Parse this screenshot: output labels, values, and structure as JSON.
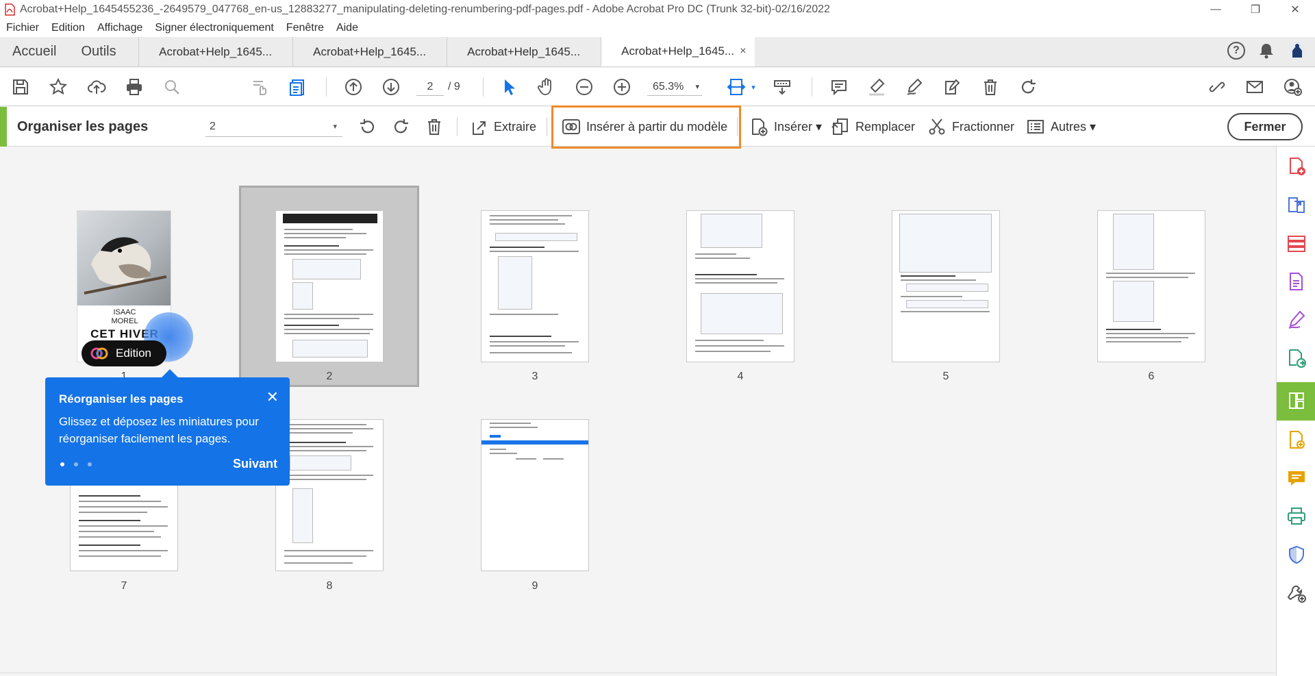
{
  "window": {
    "title": "Acrobat+Help_1645455236_-2649579_047768_en-us_12883277_manipulating-deleting-renumbering-pdf-pages.pdf - Adobe Acrobat Pro DC (Trunk 32-bit)-02/16/2022",
    "controls": {
      "minimize": "—",
      "restore": "❐",
      "close": "✕"
    }
  },
  "menu": [
    "Fichier",
    "Edition",
    "Affichage",
    "Signer électroniquement",
    "Fenêtre",
    "Aide"
  ],
  "tabs": {
    "home": "Accueil",
    "tools": "Outils",
    "documents": [
      "Acrobat+Help_1645...",
      "Acrobat+Help_1645...",
      "Acrobat+Help_1645...",
      "Acrobat+Help_1645..."
    ],
    "close": "×",
    "help": "?"
  },
  "toolbar": {
    "current_page": "2",
    "total_pages": "/ 9",
    "zoom": "65.3%",
    "caret": "▾"
  },
  "organize": {
    "title": "Organiser les pages",
    "page_select": "2",
    "extract": "Extraire",
    "insert_template": "Insérer à partir du modèle",
    "insert": "Insérer ▾",
    "replace": "Remplacer",
    "split": "Fractionner",
    "more": "Autres ▾",
    "close": "Fermer"
  },
  "cover": {
    "author_first": "ISAAC",
    "author_last": "MOREL",
    "book_title": "CET HIVER"
  },
  "edition_button": "Edition",
  "pages": [
    "1",
    "2",
    "3",
    "4",
    "5",
    "6",
    "7",
    "8",
    "9"
  ],
  "tooltip": {
    "title": "Réorganiser les pages",
    "close": "✕",
    "body": "Glissez et déposez les miniatures pour réorganiser facilement les pages.",
    "next": "Suivant",
    "step_current": 1,
    "step_total": 3
  },
  "colors": {
    "accent_green": "#7bbd3c",
    "highlight_orange": "#f08a2c",
    "tooltip_blue": "#1473e6"
  }
}
